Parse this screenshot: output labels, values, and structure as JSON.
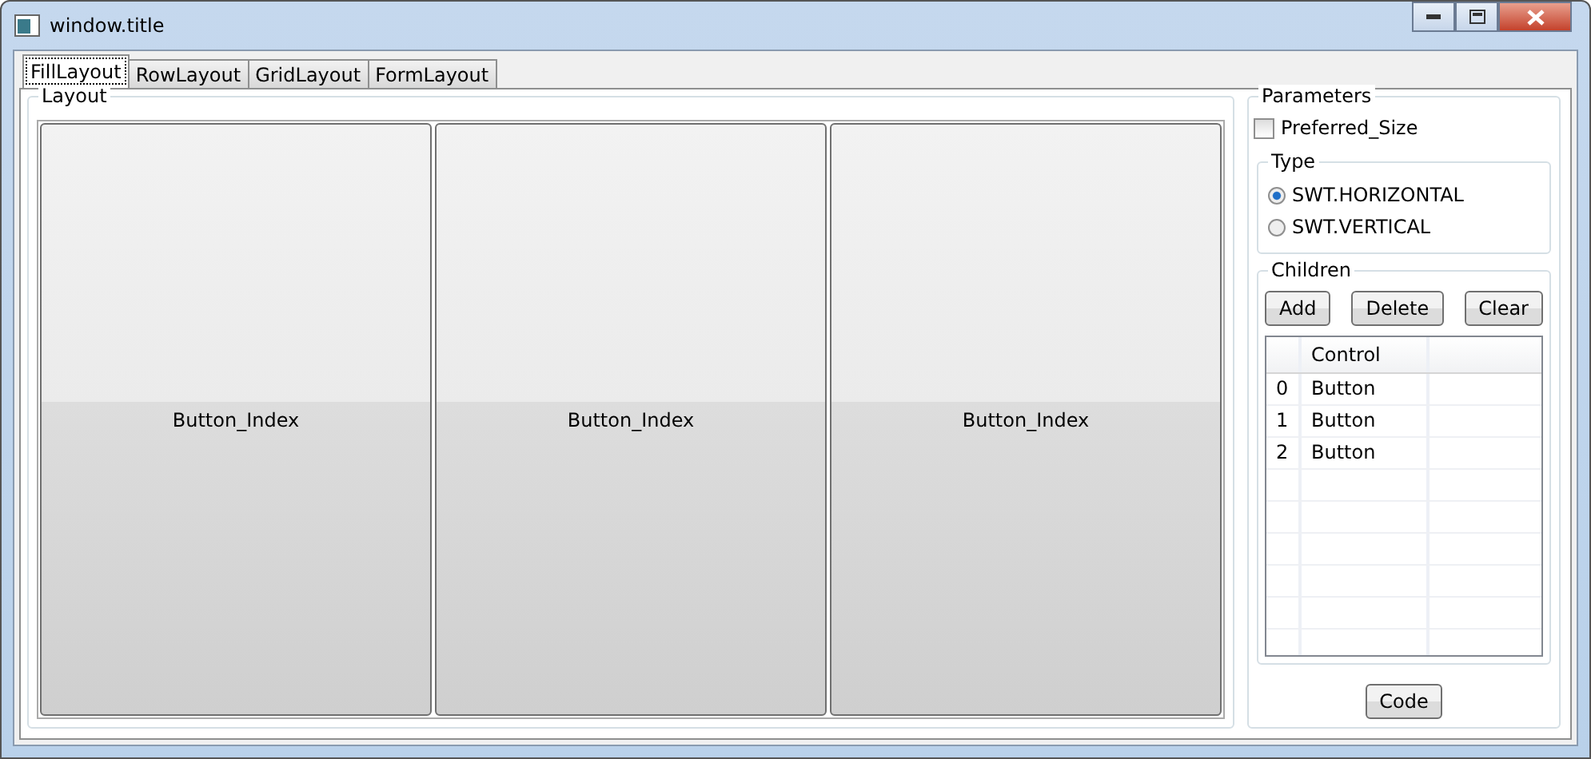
{
  "window": {
    "title": "window.title"
  },
  "tabs": [
    {
      "label": "FillLayout",
      "selected": true
    },
    {
      "label": "RowLayout",
      "selected": false
    },
    {
      "label": "GridLayout",
      "selected": false
    },
    {
      "label": "FormLayout",
      "selected": false
    }
  ],
  "layout": {
    "title": "Layout",
    "buttons": [
      "Button_Index",
      "Button_Index",
      "Button_Index"
    ]
  },
  "parameters": {
    "title": "Parameters",
    "preferred_size": {
      "label": "Preferred_Size",
      "checked": false
    },
    "type": {
      "title": "Type",
      "options": [
        {
          "label": "SWT.HORIZONTAL",
          "selected": true
        },
        {
          "label": "SWT.VERTICAL",
          "selected": false
        }
      ]
    },
    "children": {
      "title": "Children",
      "buttons": [
        "Add",
        "Delete",
        "Clear"
      ],
      "table": {
        "columns": [
          "Control"
        ],
        "rows": [
          {
            "index": "0",
            "control": "Button"
          },
          {
            "index": "1",
            "control": "Button"
          },
          {
            "index": "2",
            "control": "Button"
          }
        ]
      }
    },
    "code_button": "Code"
  }
}
